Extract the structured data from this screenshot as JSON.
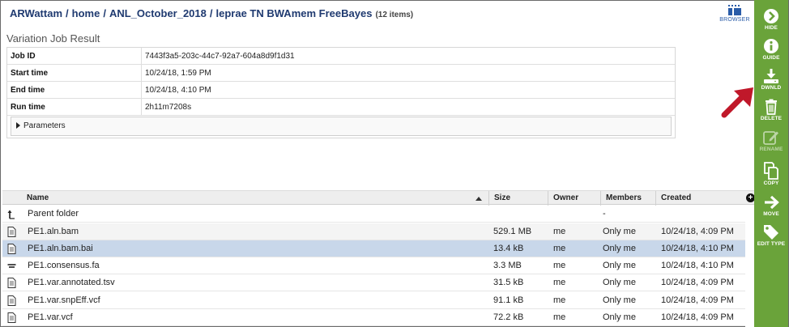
{
  "breadcrumb": {
    "segments": [
      "ARWattam",
      "home",
      "ANL_October_2018"
    ],
    "separator": "/",
    "current": "leprae TN BWAmem FreeBayes",
    "count": "(12 items)"
  },
  "browser_button": {
    "label": "BROWSER",
    "icon": "grid-icon"
  },
  "section_title": "Variation Job Result",
  "job": {
    "rows": [
      {
        "key": "Job ID",
        "value": "7443f3a5-203c-44c7-92a7-604a8d9f1d31"
      },
      {
        "key": "Start time",
        "value": "10/24/18, 1:59 PM"
      },
      {
        "key": "End time",
        "value": "10/24/18, 4:10 PM"
      },
      {
        "key": "Run time",
        "value": "2h11m7208s"
      }
    ],
    "parameters_label": "Parameters"
  },
  "grid": {
    "columns": [
      "Name",
      "Size",
      "Owner",
      "Members",
      "Created"
    ],
    "parent_row": {
      "name": "Parent folder",
      "members": "-"
    },
    "rows": [
      {
        "name": "PE1.aln.bam",
        "size": "529.1 MB",
        "owner": "me",
        "members": "Only me",
        "created": "10/24/18, 4:09 PM",
        "icon": "file-icon"
      },
      {
        "name": "PE1.aln.bam.bai",
        "size": "13.4 kB",
        "owner": "me",
        "members": "Only me",
        "created": "10/24/18, 4:10 PM",
        "icon": "file-icon",
        "selected": true
      },
      {
        "name": "PE1.consensus.fa",
        "size": "3.3 MB",
        "owner": "me",
        "members": "Only me",
        "created": "10/24/18, 4:10 PM",
        "icon": "sequence-icon"
      },
      {
        "name": "PE1.var.annotated.tsv",
        "size": "31.5 kB",
        "owner": "me",
        "members": "Only me",
        "created": "10/24/18, 4:09 PM",
        "icon": "file-icon"
      },
      {
        "name": "PE1.var.snpEff.vcf",
        "size": "91.1 kB",
        "owner": "me",
        "members": "Only me",
        "created": "10/24/18, 4:09 PM",
        "icon": "file-icon"
      },
      {
        "name": "PE1.var.vcf",
        "size": "72.2 kB",
        "owner": "me",
        "members": "Only me",
        "created": "10/24/18, 4:09 PM",
        "icon": "file-icon"
      }
    ]
  },
  "sidebar": {
    "color": "#6aa33a",
    "buttons": [
      {
        "label": "HIDE",
        "icon": "chevron-right-circle-icon"
      },
      {
        "label": "GUIDE",
        "icon": "info-icon"
      },
      {
        "label": "DWNLD",
        "icon": "download-icon"
      },
      {
        "label": "DELETE",
        "icon": "trash-icon"
      },
      {
        "label": "RENAME",
        "icon": "edit-icon",
        "disabled": true
      },
      {
        "label": "COPY",
        "icon": "copy-icon"
      },
      {
        "label": "MOVE",
        "icon": "arrow-right-icon"
      },
      {
        "label": "EDIT TYPE",
        "icon": "tag-icon"
      }
    ]
  },
  "annotation": {
    "color": "#c0182a",
    "icon": "pointer-arrow-icon"
  }
}
